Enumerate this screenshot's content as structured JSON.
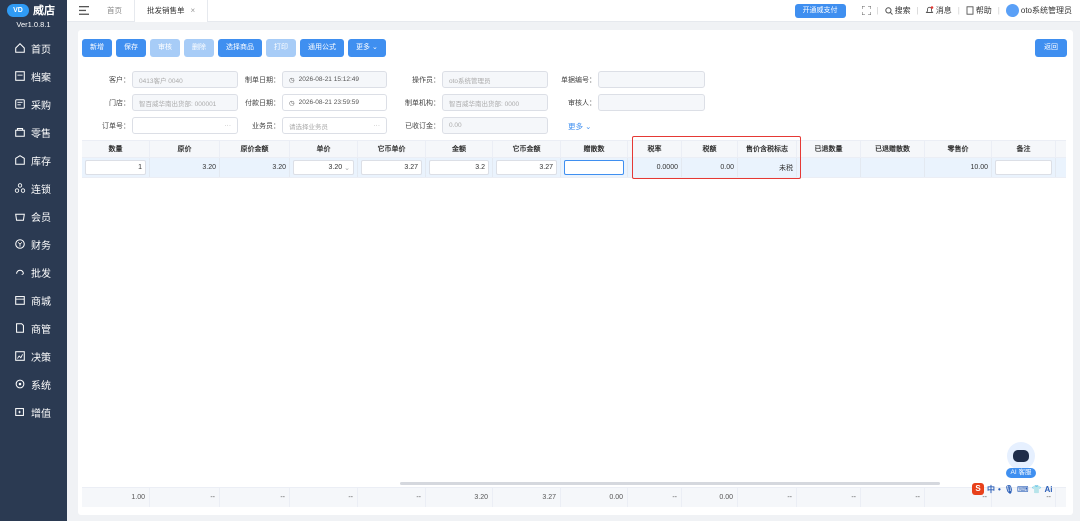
{
  "app": {
    "brand": "威店",
    "version": "Ver1.0.8.1"
  },
  "sidebar": {
    "items": [
      {
        "label": "首页",
        "icon": "home-icon"
      },
      {
        "label": "档案",
        "icon": "archive-icon"
      },
      {
        "label": "采购",
        "icon": "purchase-icon"
      },
      {
        "label": "零售",
        "icon": "retail-icon"
      },
      {
        "label": "库存",
        "icon": "inventory-icon"
      },
      {
        "label": "连锁",
        "icon": "chain-icon"
      },
      {
        "label": "会员",
        "icon": "member-icon"
      },
      {
        "label": "财务",
        "icon": "finance-icon"
      },
      {
        "label": "批发",
        "icon": "wholesale-icon"
      },
      {
        "label": "商城",
        "icon": "mall-icon"
      },
      {
        "label": "商管",
        "icon": "merchant-icon"
      },
      {
        "label": "决策",
        "icon": "decision-icon"
      },
      {
        "label": "系统",
        "icon": "system-icon"
      },
      {
        "label": "增值",
        "icon": "value-added-icon"
      }
    ]
  },
  "topbar": {
    "tabs": [
      {
        "label": "首页"
      },
      {
        "label": "批发销售单",
        "close": "×"
      }
    ],
    "pay_button": "开通威支付",
    "search": "搜索",
    "messages": "消息",
    "help": "帮助",
    "user": "oto系统管理员"
  },
  "toolbar": {
    "buttons": [
      "新增",
      "保存",
      "审核",
      "删除",
      "选择商品",
      "打印",
      "通用公式",
      "更多"
    ],
    "return": "返回"
  },
  "form": {
    "customer_label": "客户：",
    "customer_value": "0413客户 0040",
    "doc_date_label": "制单日期：",
    "doc_date_value": "2026-08-21 15:12:49",
    "operator_label": "操作员：",
    "operator_value": "oto系统管理员",
    "doc_no_label": "单据编号：",
    "doc_no_value": "",
    "store_label": "门店：",
    "store_value": "智百威华南出货部: 000001",
    "pay_date_label": "付款日期：",
    "pay_date_value": "2026-08-21 23:59:59",
    "org_label": "制单机构：",
    "org_value": "智百威华南出货部: 0000",
    "reviewer_label": "审核人：",
    "reviewer_value": "",
    "order_label": "订单号：",
    "order_value": "",
    "order_dots": "···",
    "salesman_label": "业务员：",
    "salesman_placeholder": "请选择业务员",
    "salesman_dots": "···",
    "deposit_label": "已收订金：",
    "deposit_value": "0.00",
    "more": "更多"
  },
  "table": {
    "headers": [
      "数量",
      "原价",
      "原价金额",
      "单价",
      "它币单价",
      "金额",
      "它币金额",
      "赠散数",
      "税率",
      "税额",
      "售价含税标志",
      "已退数量",
      "已退赠散数",
      "零售价",
      "备注"
    ],
    "row": {
      "qty": "1",
      "orig_price": "3.20",
      "orig_amount": "3.20",
      "unit_price": "3.20",
      "fc_unit_price": "3.27",
      "amount": "3.2",
      "fc_amount": "3.27",
      "gift_qty": "",
      "tax_rate": "0.0000",
      "tax_amount": "0.00",
      "tax_flag": "未税",
      "returned_qty": "",
      "returned_gift": "",
      "retail_price": "10.00",
      "remark": ""
    },
    "footer": [
      "1.00",
      "--",
      "--",
      "--",
      "--",
      "3.20",
      "3.27",
      "0.00",
      "--",
      "0.00",
      "--",
      "--",
      "--",
      "--",
      "--"
    ]
  },
  "ai": {
    "label": "AI 客服"
  },
  "ime": {
    "chars": "中",
    "ai": "Ai"
  }
}
